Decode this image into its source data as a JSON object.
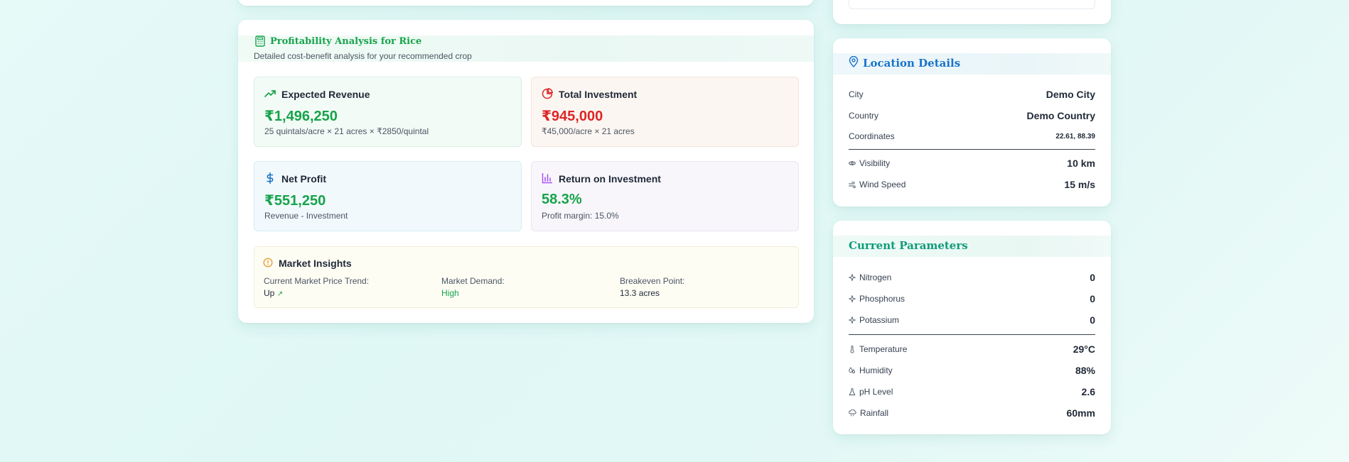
{
  "profitability": {
    "title": "Profitability Analysis for Rice",
    "subtitle": "Detailed cost-benefit analysis for your recommended crop",
    "revenue": {
      "label": "Expected Revenue",
      "value": "₹1,496,250",
      "note": "25 quintals/acre × 21 acres × ₹2850/quintal",
      "color": "#16a34a",
      "icon": "trending-up-icon"
    },
    "investment": {
      "label": "Total Investment",
      "value": "₹945,000",
      "note": "₹45,000/acre × 21 acres",
      "color": "#dc2626",
      "icon": "pie-chart-icon"
    },
    "net_profit": {
      "label": "Net Profit",
      "value": "₹551,250",
      "note": "Revenue - Investment",
      "color": "#16a34a",
      "icon": "dollar-icon"
    },
    "roi": {
      "label": "Return on Investment",
      "value": "58.3%",
      "note": "Profit margin: 15.0%",
      "color": "#16a34a",
      "icon": "bar-chart-icon"
    },
    "insights": {
      "title": "Market Insights",
      "trend_label": "Current Market Price Trend:",
      "trend_value": "Up",
      "trend_arrow": "↗",
      "demand_label": "Market Demand:",
      "demand_value": "High",
      "breakeven_label": "Breakeven Point:",
      "breakeven_value": "13.3 acres"
    }
  },
  "location": {
    "title": "Location Details",
    "city_label": "City",
    "city_value": "Demo City",
    "country_label": "Country",
    "country_value": "Demo Country",
    "coords_label": "Coordinates",
    "coords_value": "22.61, 88.39",
    "visibility_label": "Visibility",
    "visibility_value": "10 km",
    "wind_label": "Wind Speed",
    "wind_value": "15 m/s"
  },
  "parameters": {
    "title": "Current Parameters",
    "nitrogen_label": "Nitrogen",
    "nitrogen_value": "0",
    "phosphorus_label": "Phosphorus",
    "phosphorus_value": "0",
    "potassium_label": "Potassium",
    "potassium_value": "0",
    "temperature_label": "Temperature",
    "temperature_value": "29°C",
    "humidity_label": "Humidity",
    "humidity_value": "88%",
    "ph_label": "pH Level",
    "ph_value": "2.6",
    "rainfall_label": "Rainfall",
    "rainfall_value": "60mm"
  },
  "colors": {
    "green": "#16a34a",
    "red": "#dc2626",
    "blue": "#1a73c8",
    "teal": "#0f9c7a",
    "amber": "#e6a23c",
    "purple": "#a855f7"
  }
}
